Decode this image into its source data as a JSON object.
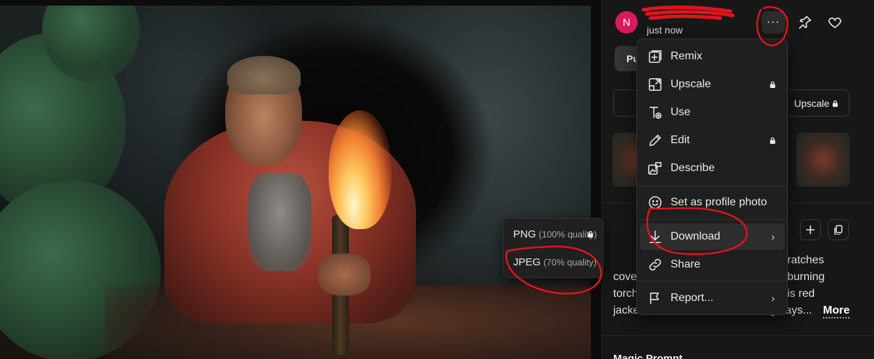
{
  "header": {
    "avatar_initial": "N",
    "timestamp": "just now",
    "more_label": "···"
  },
  "panel": {
    "pill_tab_label": "Pu",
    "upscale_button_label": "Upscale",
    "prompt_lines": [
      "ratches",
      "burning",
      "is red",
      "g days..."
    ],
    "prompt_left_fragments": [
      "cove",
      "torch",
      "jacke"
    ],
    "more_link": "More",
    "bottom_heading": "Magic Prompt"
  },
  "menu": {
    "items": [
      {
        "label": "Remix",
        "icon": "remix-icon",
        "locked": false
      },
      {
        "label": "Upscale",
        "icon": "upscale-icon",
        "locked": true
      },
      {
        "label": "Use",
        "icon": "use-text-icon",
        "locked": false
      },
      {
        "label": "Edit",
        "icon": "pencil-icon",
        "locked": true
      },
      {
        "label": "Describe",
        "icon": "describe-icon",
        "locked": false
      },
      {
        "label": "Set as profile photo",
        "icon": "smiley-icon",
        "locked": false
      },
      {
        "label": "Download",
        "icon": "download-icon",
        "has_submenu": true,
        "active": true
      },
      {
        "label": "Share",
        "icon": "link-icon",
        "locked": false
      },
      {
        "label": "Report...",
        "icon": "flag-icon",
        "has_submenu": true
      }
    ]
  },
  "download_submenu": {
    "items": [
      {
        "format": "PNG",
        "quality": "(100% quality)",
        "locked": true
      },
      {
        "format": "JPEG",
        "quality": "(70% quality)",
        "locked": false
      }
    ]
  },
  "colors": {
    "accent_avatar": "#d81b5c",
    "annotation": "#e0141e",
    "panel_bg": "#171717",
    "menu_bg": "#1f1f1f"
  }
}
